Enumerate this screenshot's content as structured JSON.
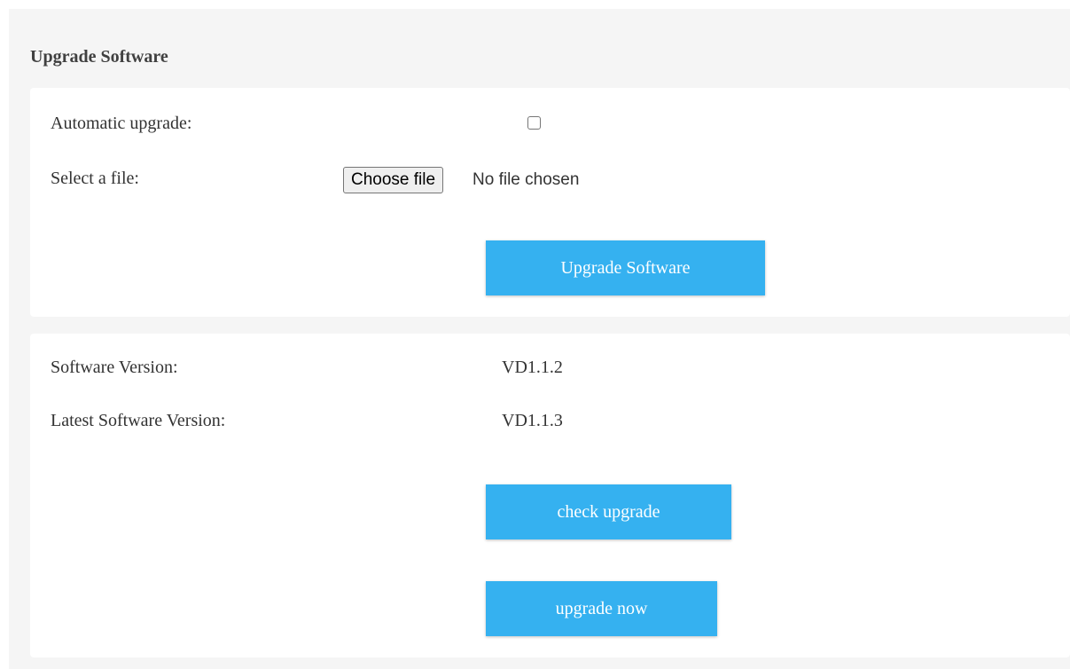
{
  "page": {
    "title": "Upgrade Software"
  },
  "upgrade_card": {
    "auto_upgrade_label": "Automatic upgrade:",
    "auto_upgrade_checked": false,
    "select_file_label": "Select a file:",
    "choose_file_button": "Choose file",
    "file_status": "No file chosen",
    "upgrade_button": "Upgrade Software"
  },
  "version_card": {
    "software_version_label": "Software Version:",
    "software_version_value": "VD1.1.2",
    "latest_version_label": "Latest Software Version:",
    "latest_version_value": "VD1.1.3",
    "check_upgrade_button": "check upgrade",
    "upgrade_now_button": "upgrade now"
  },
  "colors": {
    "accent": "#35b1f0",
    "background": "#f5f5f5",
    "card": "#ffffff"
  }
}
